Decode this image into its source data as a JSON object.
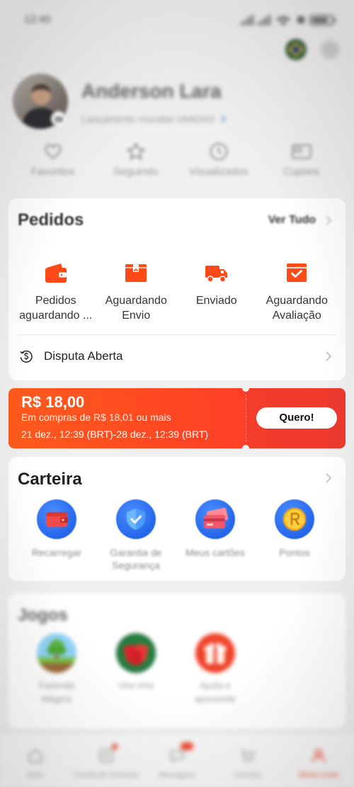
{
  "status_bar": {
    "time": "12:40"
  },
  "header": {
    "name": "Anderson Lara",
    "subtitle": "Lançamento mundial UMIDIGI"
  },
  "quick_links": [
    {
      "label": "Favoritos",
      "icon": "heart-icon"
    },
    {
      "label": "Seguindo",
      "icon": "star-icon"
    },
    {
      "label": "Visualizados",
      "icon": "clock-icon"
    },
    {
      "label": "Cupons",
      "icon": "ticket-icon"
    }
  ],
  "orders": {
    "title": "Pedidos",
    "view_all": "Ver Tudo",
    "items": [
      {
        "line1": "Pedidos",
        "line2": "aguardando ...",
        "icon": "wallet-icon"
      },
      {
        "line1": "Aguardando",
        "line2": "Envio",
        "icon": "package-icon"
      },
      {
        "line1": "Enviado",
        "icon": "truck-icon"
      },
      {
        "line1": "Aguardando",
        "line2": "Avaliação",
        "icon": "review-check-icon"
      }
    ],
    "dispute": {
      "label": "Disputa Aberta",
      "icon": "dispute-dollar-icon"
    }
  },
  "coupon": {
    "amount": "R$ 18,00",
    "condition": "Em compras de R$ 18,01 ou mais",
    "validity": "21 dez., 12:39 (BRT)-28 dez., 12:39 (BRT)",
    "button": "Quero!"
  },
  "wallet": {
    "title": "Carteira",
    "items": [
      {
        "line1": "Recarregar",
        "icon": "wallet-topup-icon"
      },
      {
        "line1": "Garantia de",
        "line2": "Segurança",
        "icon": "shield-check-icon"
      },
      {
        "line1": "Meus cartões",
        "icon": "credit-card-icon"
      },
      {
        "line1": "Pontos",
        "icon": "coin-points-icon"
      }
    ]
  },
  "games": {
    "title": "Jogos",
    "items": [
      {
        "line1": "Fazenda",
        "line2": "Mágica",
        "icon": "farm-game-icon"
      },
      {
        "line1": "Vira-Vira",
        "icon": "cards-game-icon"
      },
      {
        "line1": "Ajuda e",
        "line2": "apresente",
        "icon": "gift-game-icon"
      }
    ]
  },
  "bottom_nav": {
    "items": [
      {
        "label": "Início",
        "icon": "home-icon",
        "active": false
      },
      {
        "label": "Central de Conteúdo",
        "icon": "content-feed-icon",
        "active": false
      },
      {
        "label": "Mensagens",
        "icon": "message-icon",
        "active": false
      },
      {
        "label": "Carrinho",
        "icon": "cart-icon",
        "active": false
      },
      {
        "label": "Minha Conta",
        "icon": "account-icon",
        "active": true
      }
    ]
  },
  "colors": {
    "accent": "#ff4a17",
    "coupon_left": "#ff5a1c",
    "coupon_right": "#ee3a2e",
    "nav_active": "#f0442c",
    "page_bg": "#f0f0f0",
    "card_bg": "#ffffff"
  }
}
